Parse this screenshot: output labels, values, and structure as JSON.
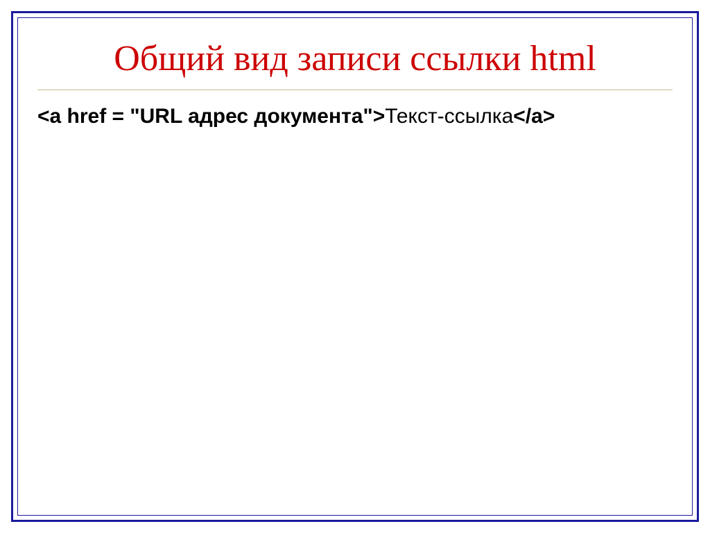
{
  "slide": {
    "title": "Общий вид записи ссылки html",
    "code_bold": "<a href = \"URL адрес документа\">",
    "code_normal": "Текст-ссылка",
    "code_close": "</a>"
  }
}
